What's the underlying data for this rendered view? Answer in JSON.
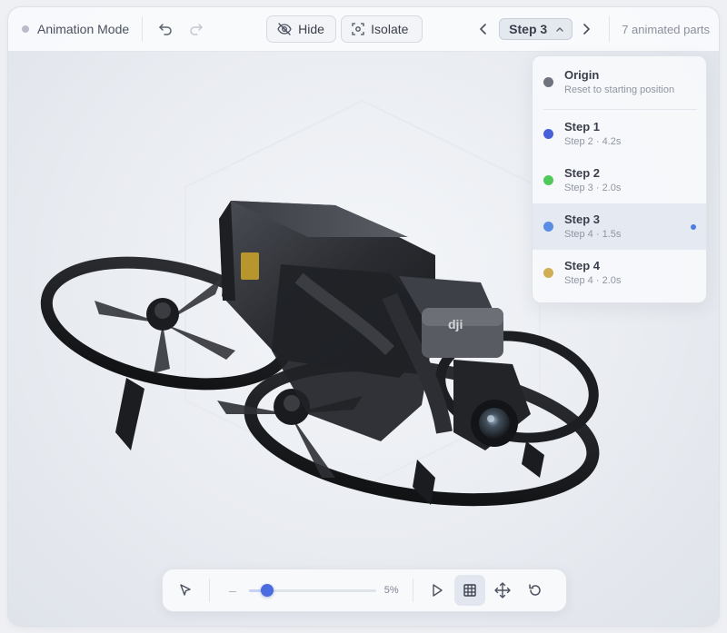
{
  "header": {
    "mode_label": "Animation Mode",
    "hide_label": "Hide",
    "isolate_label": "Isolate",
    "current_step": "Step 3",
    "parts_count": "7 animated parts"
  },
  "steps_menu": {
    "origin": {
      "title": "Origin",
      "subtitle": "Reset to starting position",
      "color": "#6f737d"
    },
    "items": [
      {
        "title": "Step 1",
        "subtitle": "Step 2 · 4.2s",
        "color": "#4861d9"
      },
      {
        "title": "Step 2",
        "subtitle": "Step 3 · 2.0s",
        "color": "#4fca5a"
      },
      {
        "title": "Step 3",
        "subtitle": "Step 4 · 1.5s",
        "color": "#5b8de3"
      },
      {
        "title": "Step 4",
        "subtitle": "Step 4 · 2.0s",
        "color": "#cfae55"
      }
    ],
    "active_index": 2
  },
  "toolbar": {
    "progress_percent": 5,
    "progress_label": "5%",
    "tools": [
      "select-tool",
      "play",
      "grid-view",
      "move-tool",
      "reset"
    ],
    "active_tool": "grid-view"
  },
  "brand": {
    "logo_text": "dji"
  },
  "colors": {
    "accent": "#4b6ce0",
    "active_step_bg": "#e4e9f2"
  }
}
